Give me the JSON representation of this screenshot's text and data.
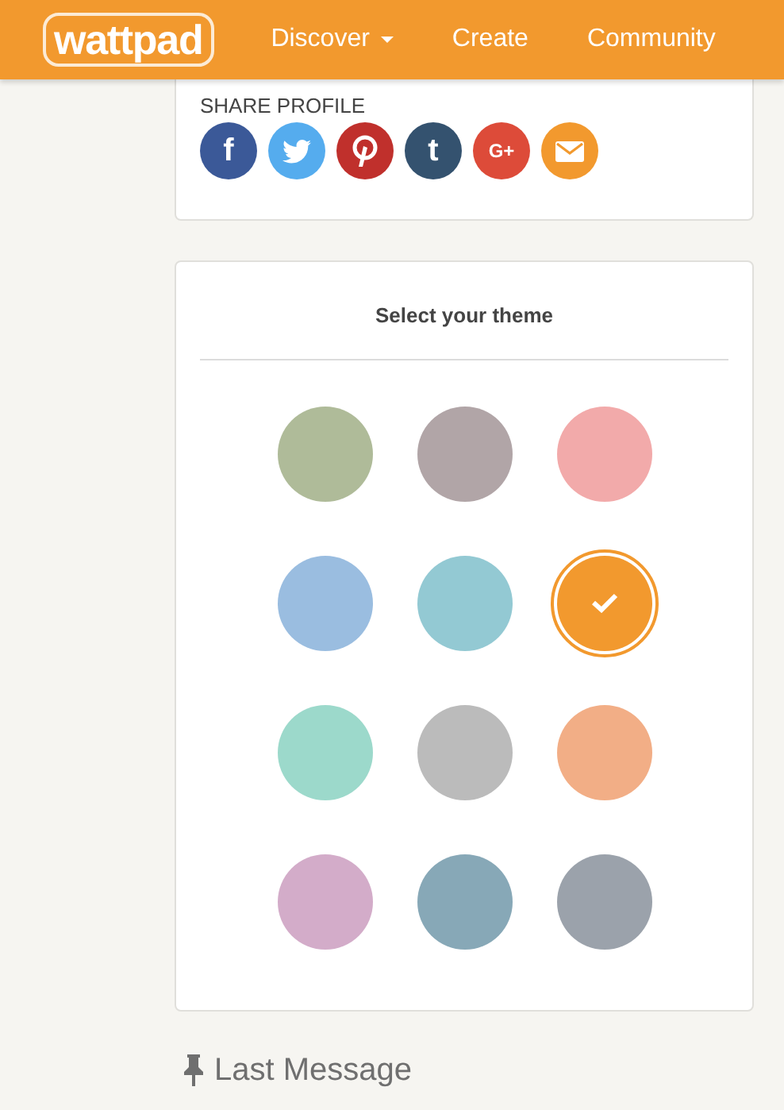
{
  "header": {
    "logo": "wattpad",
    "nav": [
      {
        "label": "Discover",
        "dropdown": true
      },
      {
        "label": "Create",
        "dropdown": false
      },
      {
        "label": "Community",
        "dropdown": false
      }
    ]
  },
  "share_profile": {
    "title": "SHARE PROFILE",
    "buttons": [
      {
        "kind": "facebook",
        "glyph": "f",
        "color": "#3b5998"
      },
      {
        "kind": "twitter",
        "color": "#55acee"
      },
      {
        "kind": "pinterest",
        "color": "#c0302c"
      },
      {
        "kind": "tumblr",
        "glyph": "t",
        "color": "#34526f"
      },
      {
        "kind": "googleplus",
        "glyph": "G+",
        "color": "#dd4b39"
      },
      {
        "kind": "email",
        "color": "#f2992e"
      }
    ]
  },
  "theme": {
    "title": "Select your theme",
    "swatches": [
      {
        "color": "#afbb99",
        "selected": false
      },
      {
        "color": "#b1a5a7",
        "selected": false
      },
      {
        "color": "#f2aaaa",
        "selected": false
      },
      {
        "color": "#9abde0",
        "selected": false
      },
      {
        "color": "#93c9d3",
        "selected": false
      },
      {
        "color": "#f2992e",
        "selected": true
      },
      {
        "color": "#9cd9cb",
        "selected": false
      },
      {
        "color": "#bbbbbb",
        "selected": false
      },
      {
        "color": "#f2ae86",
        "selected": false
      },
      {
        "color": "#d3acc9",
        "selected": false
      },
      {
        "color": "#87a8b7",
        "selected": false
      },
      {
        "color": "#9ba2ab",
        "selected": false
      }
    ]
  },
  "last_message": {
    "title": "Last Message"
  }
}
